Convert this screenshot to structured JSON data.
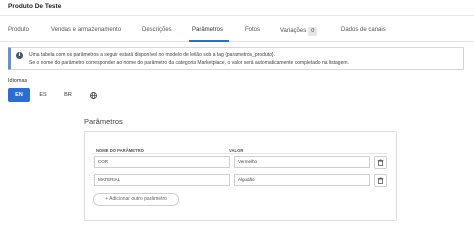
{
  "window": {
    "title": "Produto De Teste"
  },
  "tabs": [
    {
      "label": "Produto"
    },
    {
      "label": "Vendas e armazenamento"
    },
    {
      "label": "Descrições"
    },
    {
      "label": "Parâmetros"
    },
    {
      "label": "Fotos"
    },
    {
      "label": "Variações",
      "count": "0"
    },
    {
      "label": "Dados de canais"
    }
  ],
  "active_tab": "Parâmetros",
  "info": {
    "line1": "Uma tabela com os parâmetros a seguir estará disponível no modelo de leilão sob a tag {parametros_produto}.",
    "line2": "Se o nome do parâmetro corresponder ao nome do parâmetro da categoria Marketplace, o valor será automaticamente completado na listagem."
  },
  "languages": {
    "label": "Idiomas",
    "options": [
      "EN",
      "ES",
      "BR"
    ],
    "selected": "EN",
    "globe_icon": "globe-icon"
  },
  "parameters": {
    "title": "Parâmetros",
    "columns": {
      "name": "NOME DO PARÂMETRO",
      "value": "VALOR"
    },
    "rows": [
      {
        "name": "COR",
        "value": "Vermelho"
      },
      {
        "name": "MATERIAL",
        "value": "Algodão"
      }
    ],
    "add_label": "+ Adicionar outro parâmetro"
  },
  "colors": {
    "accent": "#2b6dd0",
    "info_border": "#6e8fc2"
  }
}
